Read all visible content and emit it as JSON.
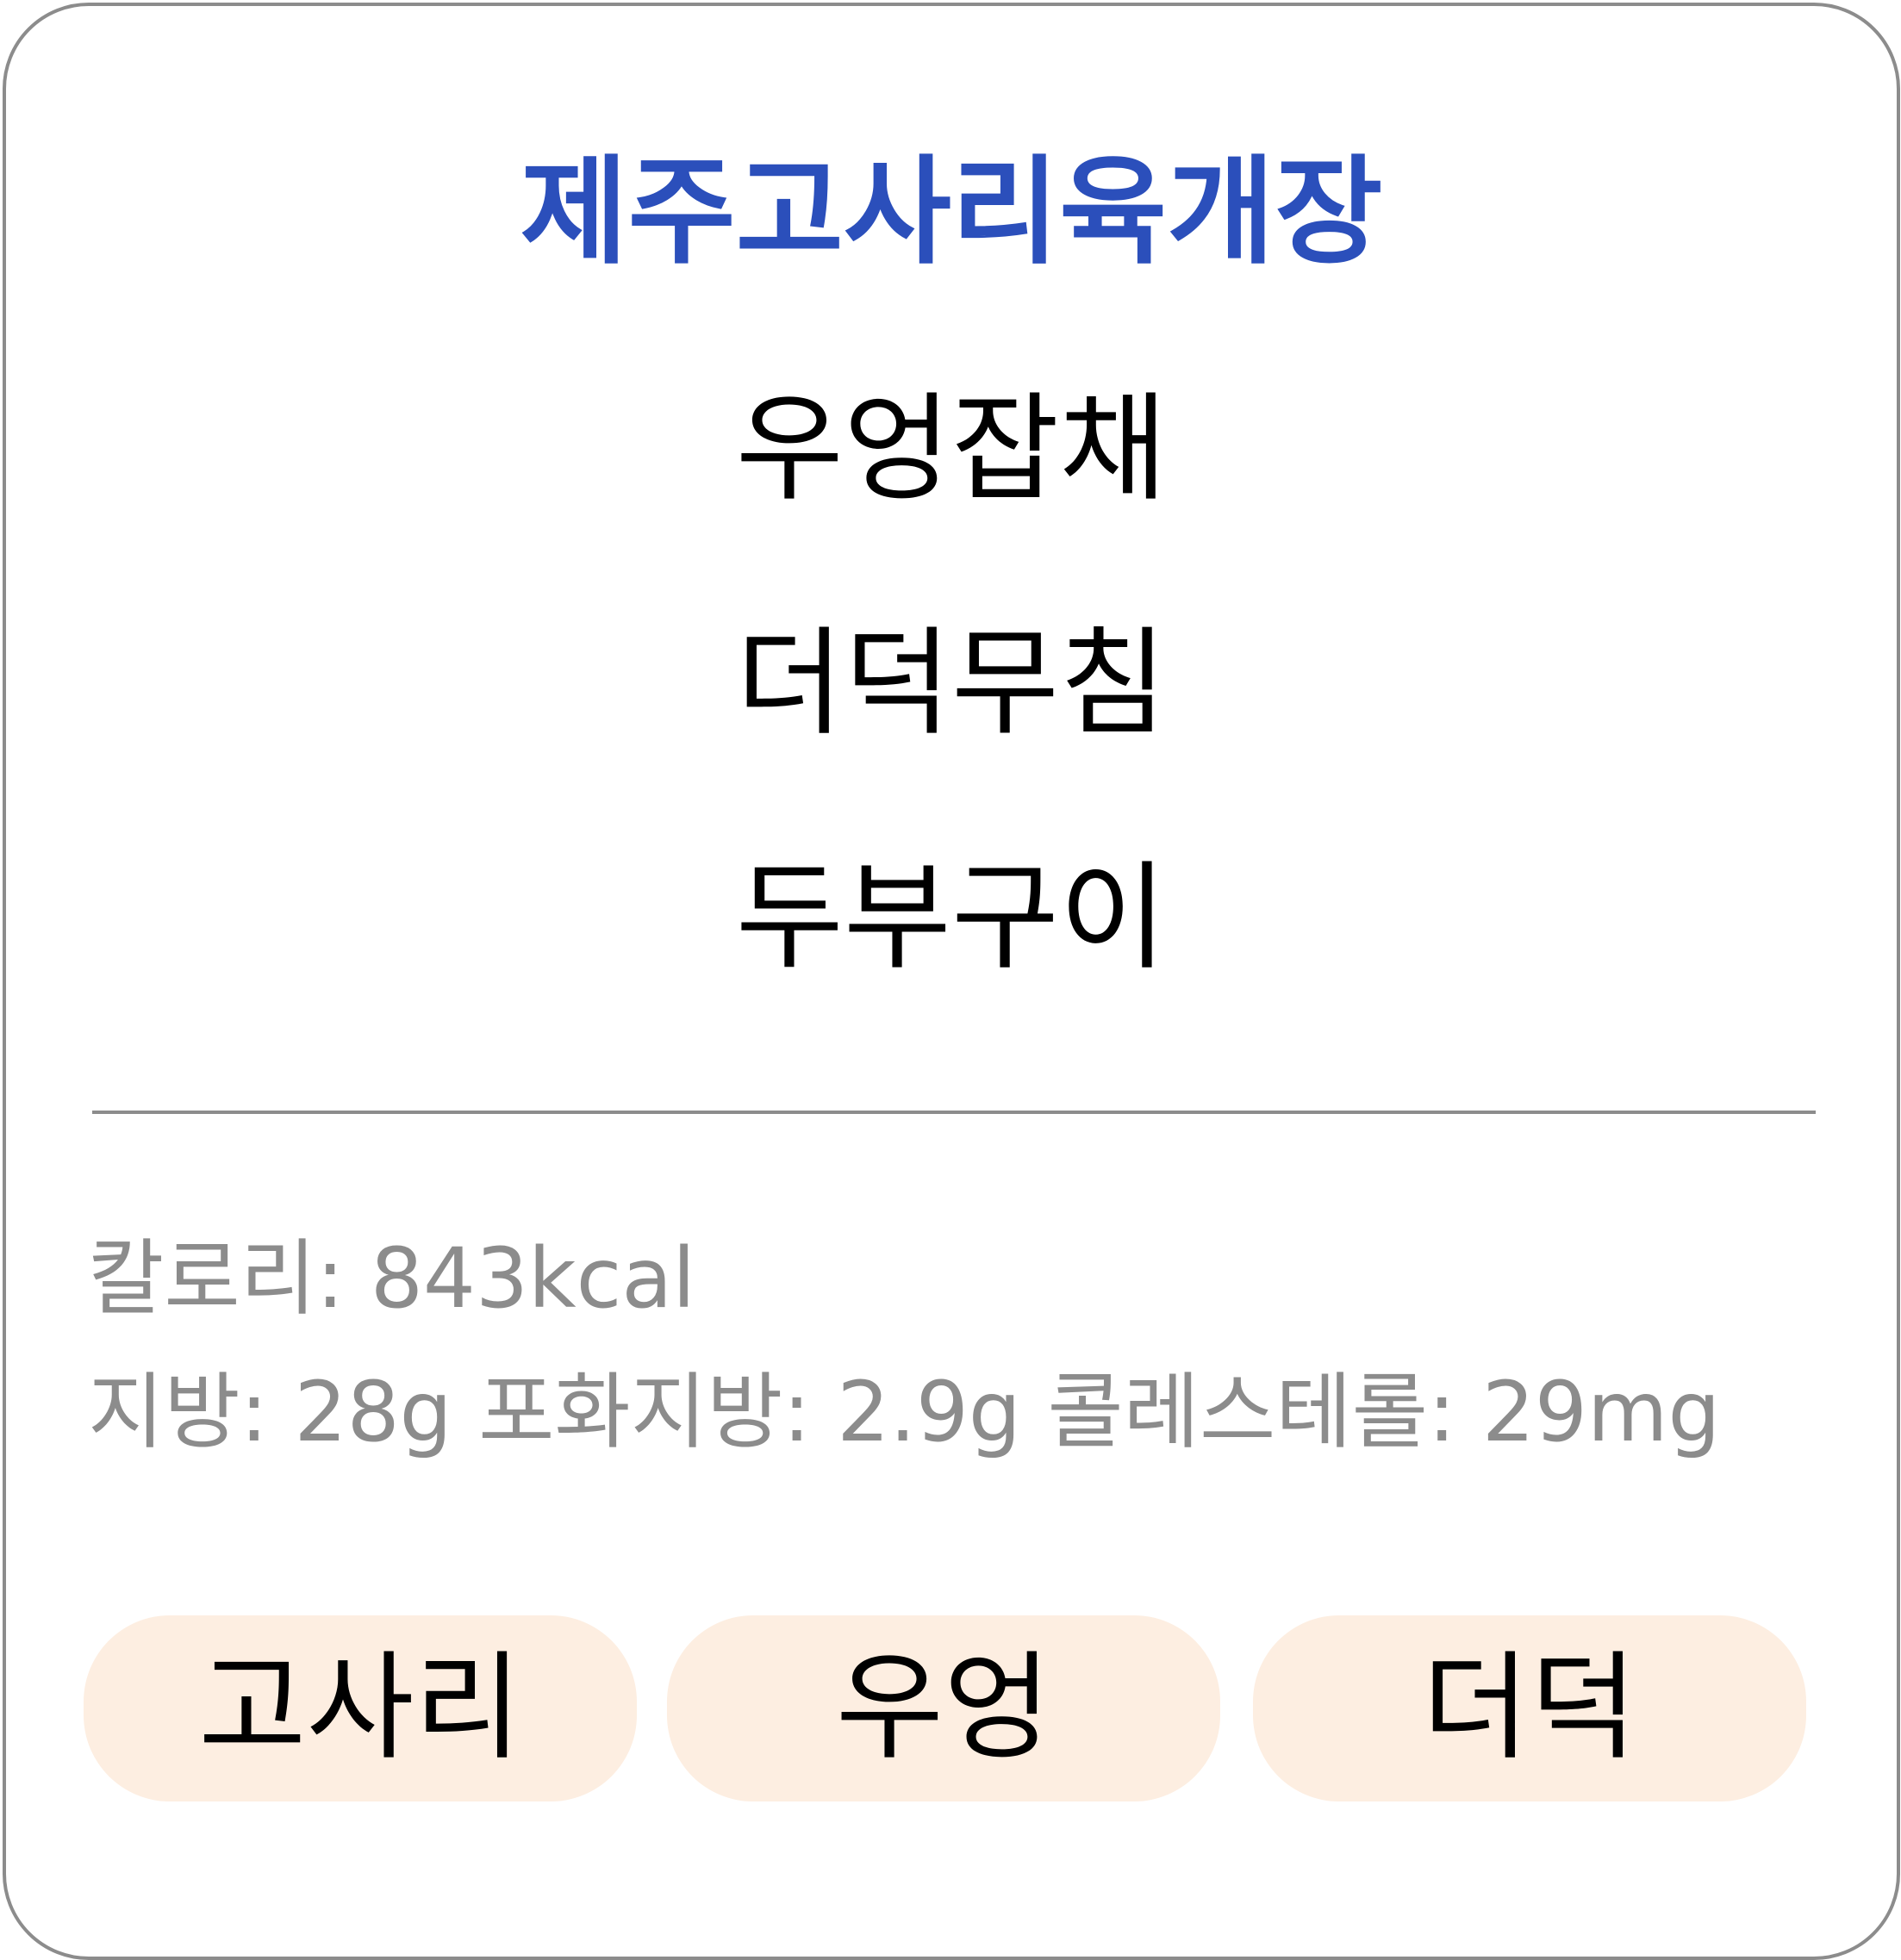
{
  "menu": {
    "main_dish": "제주고사리육개장",
    "side_dishes": [
      "우엉잡채",
      "더덕무침",
      "두부구이"
    ]
  },
  "nutrition": {
    "line1": "칼로리: 843kcal",
    "line2": "지방: 28g 포화지방: 2.9g 콜레스테롤: 29mg"
  },
  "tags": [
    "고사리",
    "우엉",
    "더덕"
  ],
  "colors": {
    "main_dish": "#2b4fbb",
    "muted_text": "#8c8c8c",
    "border": "#8c8c8c",
    "tag_background": "#fdeee1"
  }
}
